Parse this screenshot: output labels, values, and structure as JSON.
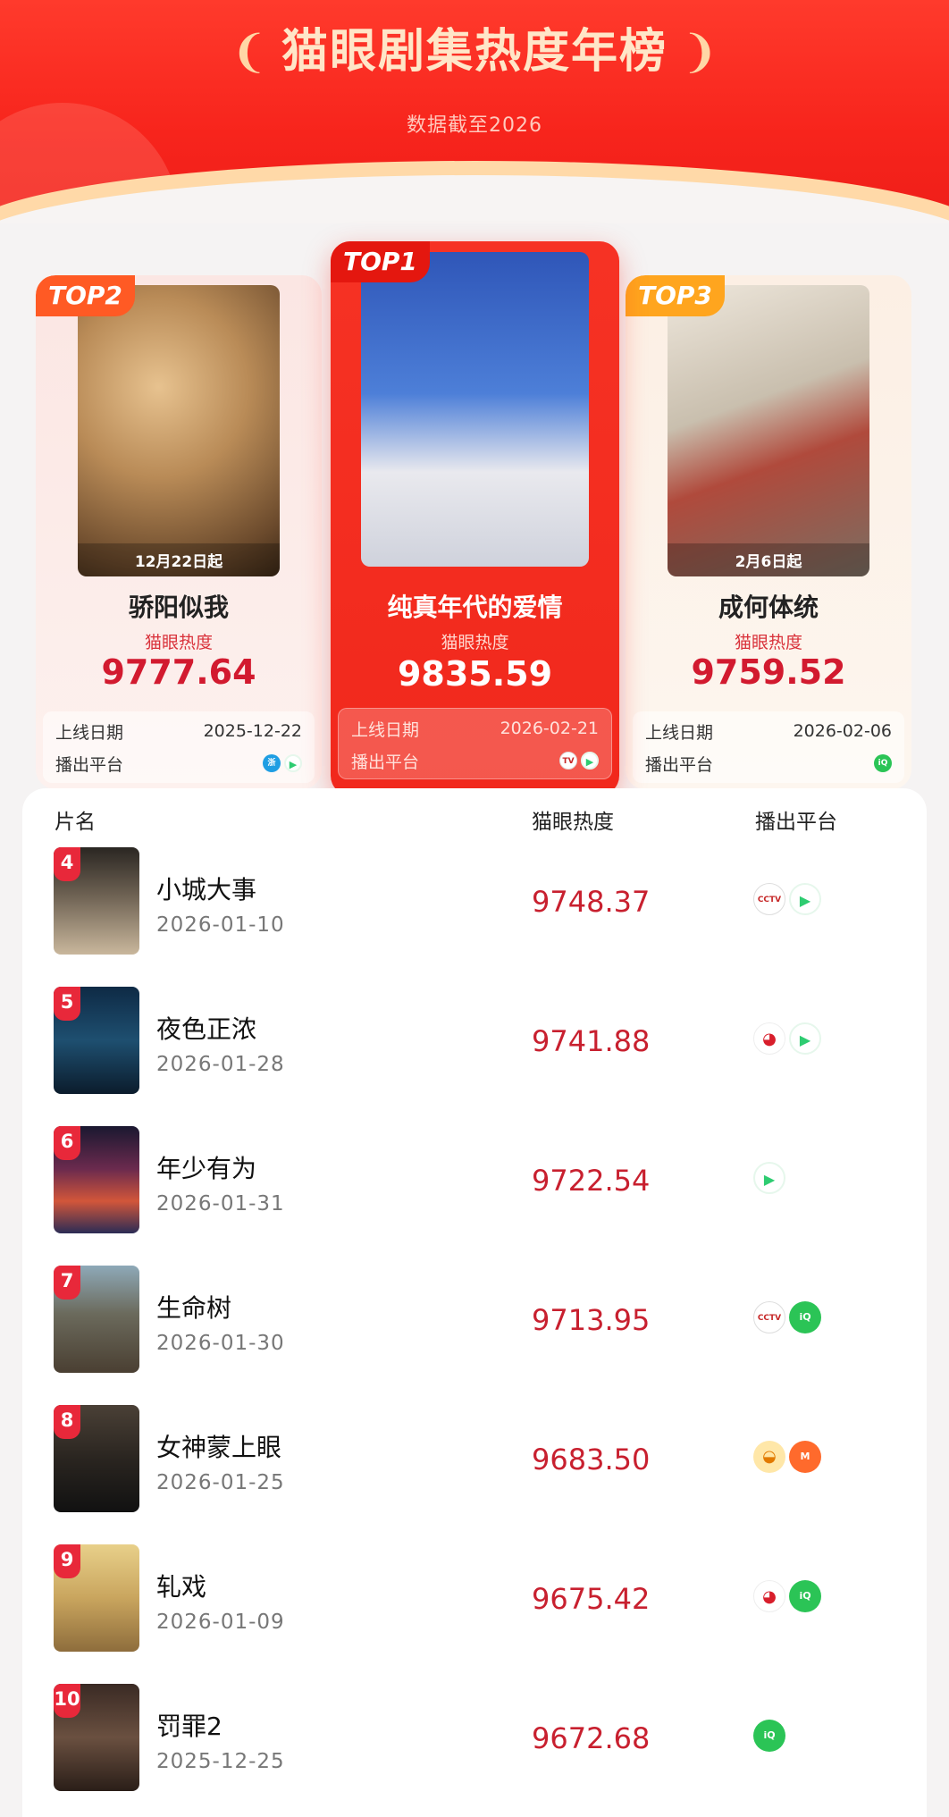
{
  "header": {
    "title": "猫眼剧集热度年榜",
    "subtitle": "数据截至2026"
  },
  "top3": [
    {
      "badge": "TOP2",
      "name": "骄阳似我",
      "heat_label": "猫眼热度",
      "heat": "9777.64",
      "date_label": "上线日期",
      "date": "2025-12-22",
      "platform_label": "播出平台",
      "poster_caption": "12月22日起",
      "platforms": [
        "zhejiang-tv-icon",
        "tencent-video-icon"
      ]
    },
    {
      "badge": "TOP1",
      "name": "纯真年代的爱情",
      "heat_label": "猫眼热度",
      "heat": "9835.59",
      "date_label": "上线日期",
      "date": "2026-02-21",
      "platform_label": "播出平台",
      "poster_caption": "",
      "platforms": [
        "cctv-icon",
        "tencent-video-icon"
      ]
    },
    {
      "badge": "TOP3",
      "name": "成何体统",
      "heat_label": "猫眼热度",
      "heat": "9759.52",
      "date_label": "上线日期",
      "date": "2026-02-06",
      "platform_label": "播出平台",
      "poster_caption": "2月6日起",
      "platforms": [
        "iqiyi-icon"
      ]
    }
  ],
  "list": {
    "headers": {
      "name": "片名",
      "heat": "猫眼热度",
      "platform": "播出平台"
    },
    "rows": [
      {
        "rank": "4",
        "name": "小城大事",
        "date": "2026-01-10",
        "heat": "9748.37",
        "platforms": [
          "cctv-icon",
          "tencent-video-icon"
        ]
      },
      {
        "rank": "5",
        "name": "夜色正浓",
        "date": "2026-01-28",
        "heat": "9741.88",
        "platforms": [
          "youku-icon",
          "tencent-video-icon"
        ]
      },
      {
        "rank": "6",
        "name": "年少有为",
        "date": "2026-01-31",
        "heat": "9722.54",
        "platforms": [
          "tencent-video-icon"
        ]
      },
      {
        "rank": "7",
        "name": "生命树",
        "date": "2026-01-30",
        "heat": "9713.95",
        "platforms": [
          "cctv-icon",
          "iqiyi-icon"
        ]
      },
      {
        "rank": "8",
        "name": "女神蒙上眼",
        "date": "2026-01-25",
        "heat": "9683.50",
        "platforms": [
          "dragon-tv-icon",
          "mango-tv-icon"
        ]
      },
      {
        "rank": "9",
        "name": "轧戏",
        "date": "2026-01-09",
        "heat": "9675.42",
        "platforms": [
          "youku-icon",
          "iqiyi-icon"
        ]
      },
      {
        "rank": "10",
        "name": "罚罪2",
        "date": "2025-12-25",
        "heat": "9672.68",
        "platforms": [
          "iqiyi-icon"
        ]
      }
    ]
  },
  "colors": {
    "brand_red": "#f1281c",
    "heat_red": "#c8202f",
    "top2_badge": "#ff5a24",
    "top3_badge": "#ffa51e"
  }
}
